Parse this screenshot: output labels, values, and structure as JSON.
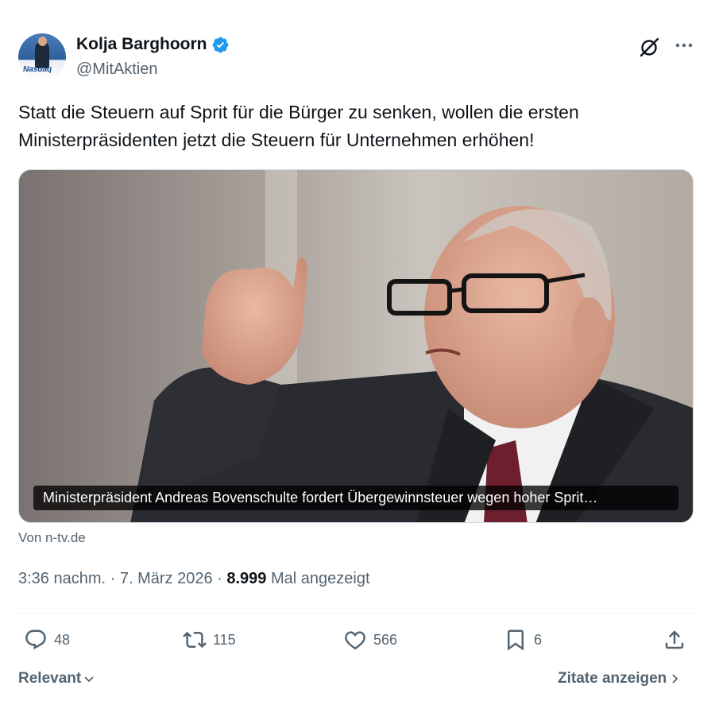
{
  "author": {
    "name": "Kolja Barghoorn",
    "handle": "@MitAktien",
    "avatar_logo": "Nasdaq",
    "verified_color": "#1d9bf0"
  },
  "tweet": {
    "text": "Statt die Steuern auf Sprit für die Bürger zu senken, wollen die ersten Ministerpräsidenten jetzt die Steuern für Unternehmen erhöhen!"
  },
  "media": {
    "caption": "Ministerpräsident Andreas Bovenschulte fordert Übergewinnsteuer wegen hoher Sprit…",
    "source": "Von n-tv.de"
  },
  "meta": {
    "time": "3:36 nachm.",
    "separator": " · ",
    "date": "7. März 2026",
    "views_count": "8.999",
    "views_label": "Mal angezeigt"
  },
  "actions": {
    "replies": "48",
    "reposts": "115",
    "likes": "566",
    "bookmarks": "6"
  },
  "footer": {
    "sort_label": "Relevant",
    "quotes_label": "Zitate anzeigen"
  },
  "icons": {
    "grok": "grok-icon",
    "more": "more-icon",
    "reply": "reply-icon",
    "repost": "repost-icon",
    "like": "heart-icon",
    "bookmark": "bookmark-icon",
    "share": "share-icon"
  }
}
